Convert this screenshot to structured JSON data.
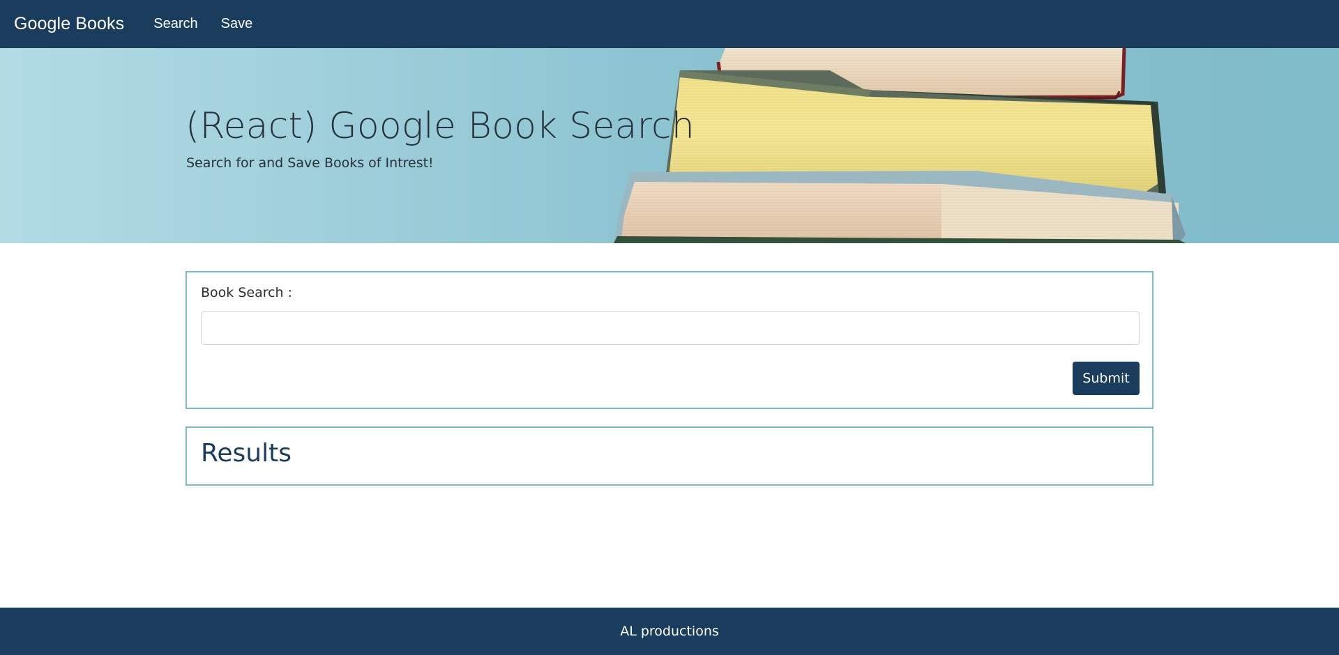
{
  "navbar": {
    "brand": "Google Books",
    "links": [
      {
        "label": "Search"
      },
      {
        "label": "Save"
      }
    ],
    "background_color": "#1a3d5e"
  },
  "hero": {
    "title": "(React) Google Book Search",
    "subtitle": "Search for and Save Books of Intrest!",
    "background_image": "stack-of-books-photo"
  },
  "search": {
    "label": "Book Search :",
    "input_value": "",
    "placeholder": "",
    "submit_label": "Submit"
  },
  "results": {
    "title": "Results"
  },
  "footer": {
    "text": "AL productions"
  },
  "colors": {
    "primary": "#1a3d5e",
    "card_border": "#7fb8c8"
  }
}
